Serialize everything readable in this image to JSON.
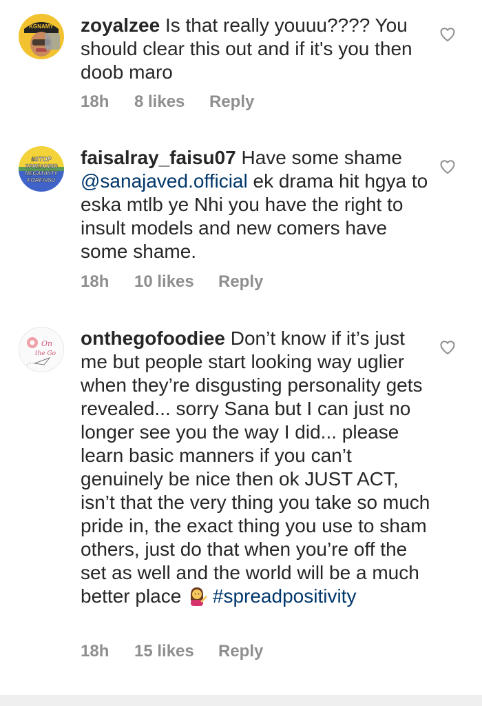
{
  "comments": [
    {
      "username": "zoyalzee",
      "text": "Is that really youuu???? You should clear this out and if it's you then doob maro",
      "time": "18h",
      "likes": "8 likes",
      "reply": "Reply",
      "avatar_icon": "profile-photo-yellow-cap",
      "avatar_text": "KGNAMY"
    },
    {
      "username": "faisalray_faisu07",
      "mention": "@sanajaved.official",
      "text_before": "Have some shame",
      "text_after": "ek drama hit hgya to eska mtlb ye Nhi you have the right to insult models and new comers have some shame.",
      "time": "18h",
      "likes": "10 likes",
      "reply": "Reply",
      "avatar_icon": "stop-negativity-badge",
      "avatar_lines": [
        "#STOP",
        "SPREADING",
        "NEGATIVITY",
        "FORFAISU"
      ]
    },
    {
      "username": "onthegofoodiee",
      "text": "Don’t know if it’s just me but people start looking way uglier when they’re disgusting personality gets revealed... sorry Sana but I can just no longer see you the way I did... please learn basic manners if you can’t genuinely be nice then ok JUST ACT, isn’t that the very thing you take so much pride in, the exact thing you use to sham others, just do that when you’re off the set as well and the world will be a much better place",
      "emoji": "woman-tipping-hand-emoji",
      "hashtag": "#spreadpositivity",
      "time": "18h",
      "likes": "15 likes",
      "reply": "Reply",
      "avatar_icon": "foodie-logo",
      "avatar_lines": [
        "On",
        "the Go"
      ]
    }
  ],
  "colors": {
    "text": "#262626",
    "meta": "#8e8e8e",
    "link": "#00376b",
    "heart_outline": "#8e8e8e"
  }
}
